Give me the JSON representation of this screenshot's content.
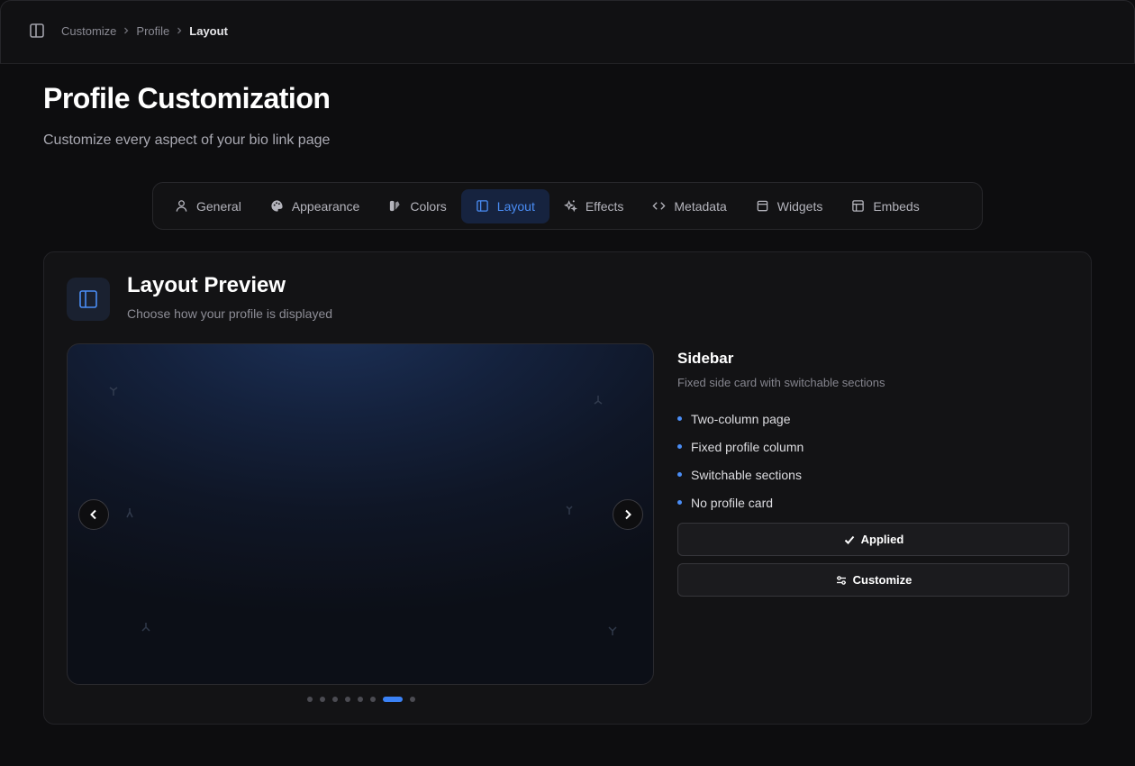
{
  "breadcrumb": {
    "items": [
      "Customize",
      "Profile"
    ],
    "current": "Layout"
  },
  "header": {
    "title": "Profile Customization",
    "subtitle": "Customize every aspect of your bio link page"
  },
  "tabs": [
    {
      "label": "General",
      "icon": "user-icon"
    },
    {
      "label": "Appearance",
      "icon": "palette-icon"
    },
    {
      "label": "Colors",
      "icon": "swatch-icon"
    },
    {
      "label": "Layout",
      "icon": "layout-panel-icon",
      "active": true
    },
    {
      "label": "Effects",
      "icon": "sparkles-icon"
    },
    {
      "label": "Metadata",
      "icon": "code-icon"
    },
    {
      "label": "Widgets",
      "icon": "widget-icon"
    },
    {
      "label": "Embeds",
      "icon": "embed-icon"
    }
  ],
  "card": {
    "title": "Layout Preview",
    "subtitle": "Choose how your profile is displayed"
  },
  "layout": {
    "name": "Sidebar",
    "description": "Fixed side card with switchable sections",
    "features": [
      "Two-column page",
      "Fixed profile column",
      "Switchable sections",
      "No profile card"
    ]
  },
  "buttons": {
    "applied": "Applied",
    "customize": "Customize"
  },
  "carousel": {
    "total_slides": 8,
    "active_index": 6
  },
  "colors": {
    "accent": "#3b82f6",
    "background": "#0d0d0f",
    "active_tab_bg": "#16233f"
  }
}
